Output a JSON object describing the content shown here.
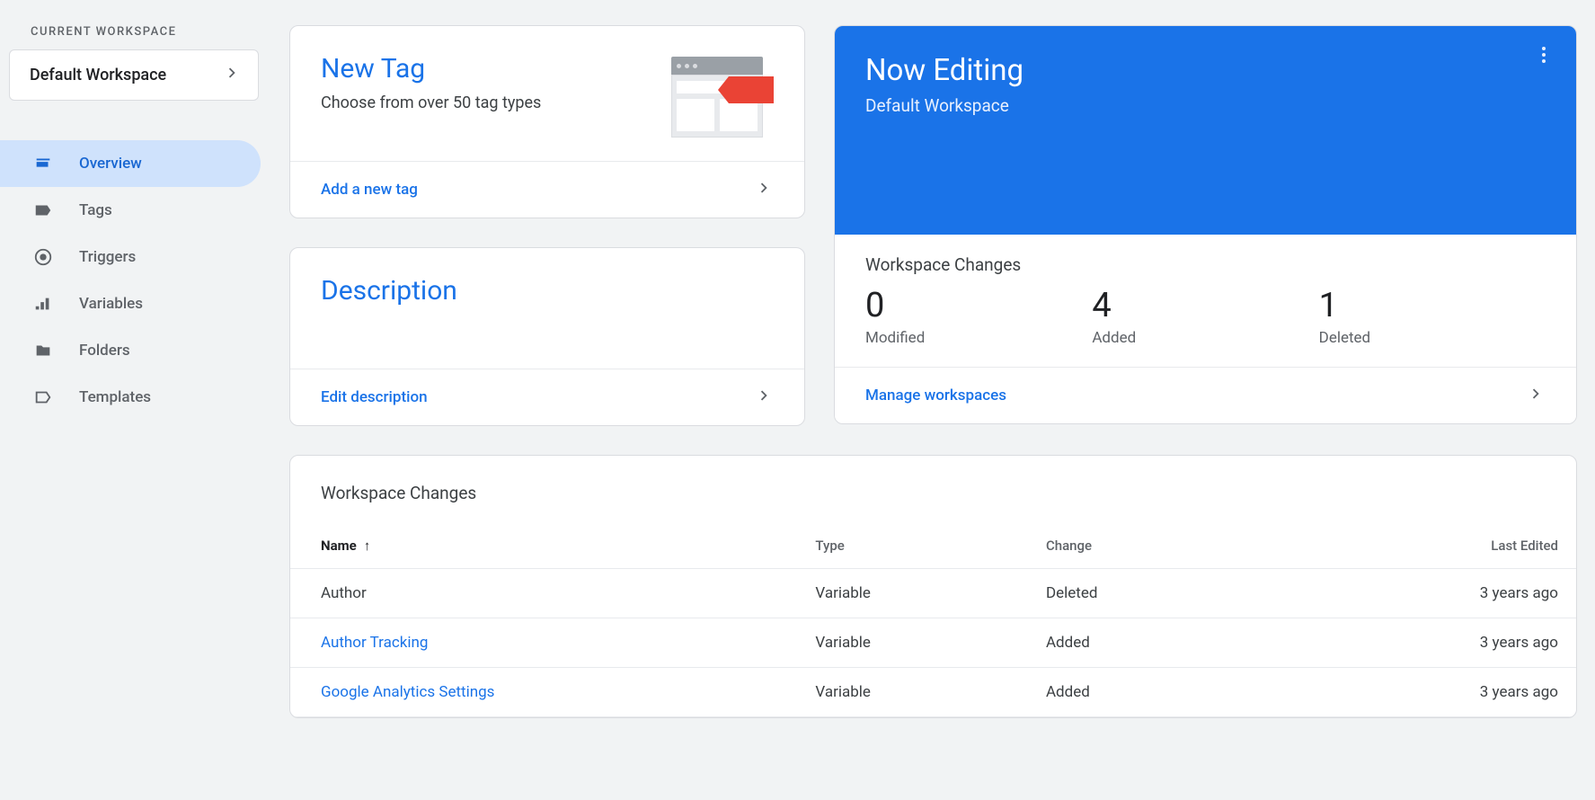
{
  "sidebar": {
    "section_label": "CURRENT WORKSPACE",
    "workspace_name": "Default Workspace",
    "nav": [
      {
        "label": "Overview",
        "icon": "dashboard",
        "active": true
      },
      {
        "label": "Tags",
        "icon": "tag",
        "active": false
      },
      {
        "label": "Triggers",
        "icon": "trigger",
        "active": false
      },
      {
        "label": "Variables",
        "icon": "variables",
        "active": false
      },
      {
        "label": "Folders",
        "icon": "folder",
        "active": false
      },
      {
        "label": "Templates",
        "icon": "template",
        "active": false
      }
    ]
  },
  "new_tag": {
    "title": "New Tag",
    "subtitle": "Choose from over 50 tag types",
    "footer": "Add a new tag"
  },
  "description": {
    "title": "Description",
    "footer": "Edit description"
  },
  "editing": {
    "title": "Now Editing",
    "workspace": "Default Workspace",
    "changes_label": "Workspace Changes",
    "stats": [
      {
        "num": "0",
        "label": "Modified"
      },
      {
        "num": "4",
        "label": "Added"
      },
      {
        "num": "1",
        "label": "Deleted"
      }
    ],
    "footer": "Manage workspaces"
  },
  "changes_table": {
    "title": "Workspace Changes",
    "headers": {
      "name": "Name",
      "type": "Type",
      "change": "Change",
      "last_edited": "Last Edited"
    },
    "rows": [
      {
        "name": "Author",
        "type": "Variable",
        "change": "Deleted",
        "last_edited": "3 years ago",
        "link": false
      },
      {
        "name": "Author Tracking",
        "type": "Variable",
        "change": "Added",
        "last_edited": "3 years ago",
        "link": true
      },
      {
        "name": "Google Analytics Settings",
        "type": "Variable",
        "change": "Added",
        "last_edited": "3 years ago",
        "link": true
      }
    ]
  }
}
